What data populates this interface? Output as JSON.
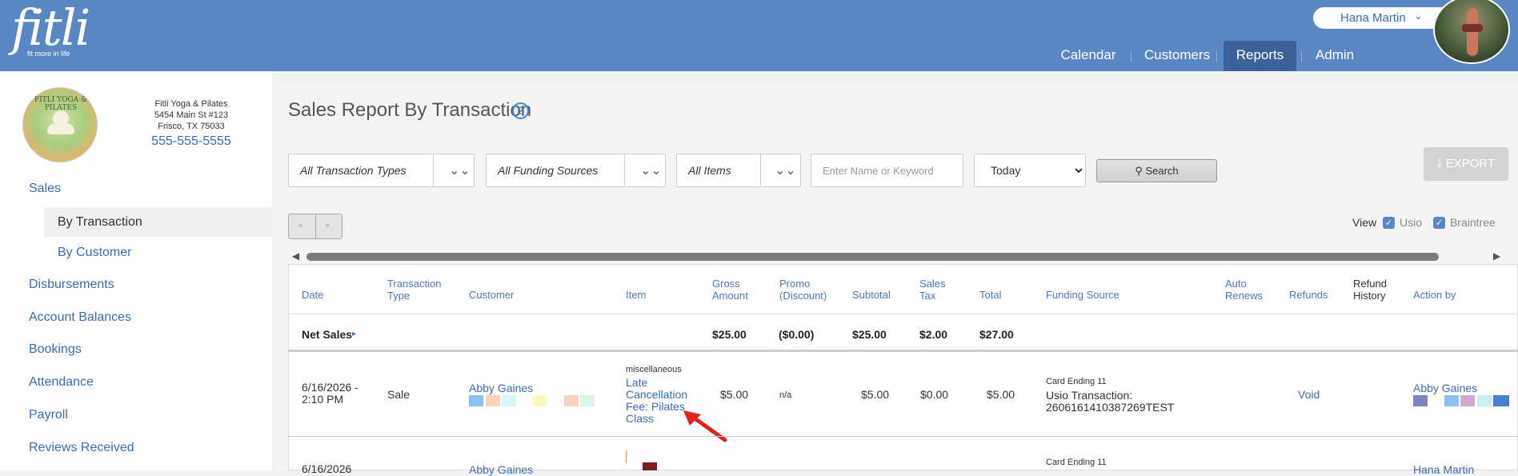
{
  "header": {
    "logo_text": "fitli",
    "logo_tagline": "fit more in life",
    "user_name": "Hana Martin",
    "nav": [
      "Calendar",
      "Customers",
      "Reports",
      "Admin"
    ],
    "active_nav": "Reports",
    "brand_color": "#5a86c4"
  },
  "sidebar": {
    "studio_logo_text": "FITLI YOGA & PILATES",
    "studio_name": "Fitli Yoga & Pilates",
    "address_line1": "5454 Main St #123",
    "address_line2": "Frisco, TX 75033",
    "phone": "555-555-5555",
    "sales": "Sales",
    "by_transaction": "By Transaction",
    "by_customer": "By Customer",
    "items": [
      "Disbursements",
      "Account Balances",
      "Bookings",
      "Attendance",
      "Payroll",
      "Reviews Received"
    ]
  },
  "main": {
    "title": "Sales Report By Transaction",
    "help_icon": "?",
    "filters": {
      "transaction_types": "All Transaction Types",
      "funding_sources": "All Funding Sources",
      "items": "All Items",
      "keyword_placeholder": "Enter Name or Keyword",
      "date_range": "Today",
      "search_label": "Search",
      "export_label": "EXPORT"
    },
    "pager": {
      "prev": "«",
      "next": "»"
    },
    "view": {
      "label": "View",
      "usio": "Usio",
      "braintree": "Braintree"
    },
    "columns": {
      "date": "Date",
      "transaction_type": "Transaction Type",
      "customer": "Customer",
      "item": "Item",
      "gross_amount": "Gross Amount",
      "promo": "Promo (Discount)",
      "subtotal": "Subtotal",
      "sales_tax": "Sales Tax",
      "total": "Total",
      "funding_source": "Funding Source",
      "auto_renews": "Auto Renews",
      "refunds": "Refunds",
      "refund_history": "Refund History",
      "action_by": "Action by"
    },
    "net_sales": {
      "label": "Net Sales",
      "gross": "$25.00",
      "promo": "($0.00)",
      "subtotal": "$25.00",
      "tax": "$2.00",
      "total": "$27.00"
    },
    "rows": [
      {
        "date": "6/16/2026 - 2:10 PM",
        "type": "Sale",
        "customer": "Abby Gaines",
        "item_category": "miscellaneous",
        "item": "Late Cancellation Fee: Pilates Class",
        "gross": "$5.00",
        "promo": "n/a",
        "subtotal": "$5.00",
        "tax": "$0.00",
        "total": "$5.00",
        "funding_card": "Card Ending 11",
        "funding_txn": "Usio Transaction: 2606161410387269TEST",
        "refund_action": "Void",
        "action_by": "Abby Gaines"
      },
      {
        "date": "6/16/2026",
        "customer": "Abby Gaines",
        "funding_card": "Card Ending 11",
        "action_by": "Hana Martin"
      }
    ]
  }
}
